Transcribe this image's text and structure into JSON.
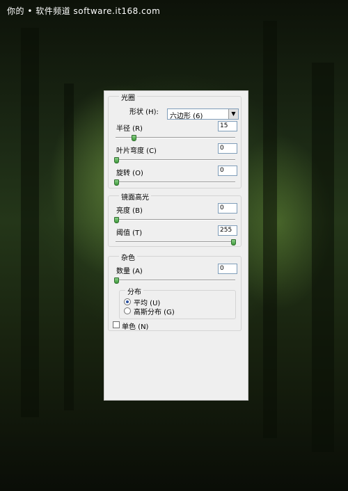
{
  "watermark": "你的 • 软件频道 software.it168.com",
  "iris": {
    "legend": "光圈",
    "shape_label": "形状 (H):",
    "shape_value": "六边形 (6)",
    "radius_label": "半径 (R)",
    "radius_value": "15",
    "radius_level": 0.15,
    "curvature_label": "叶片弯度 (C)",
    "curvature_value": "0",
    "curvature_level": 0,
    "rotation_label": "旋转 (O)",
    "rotation_value": "0",
    "rotation_level": 0
  },
  "specular": {
    "legend": "镜面高光",
    "brightness_label": "亮度 (B)",
    "brightness_value": "0",
    "brightness_level": 0,
    "threshold_label": "阈值 (T)",
    "threshold_value": "255",
    "threshold_level": 1
  },
  "noise": {
    "legend": "杂色",
    "amount_label": "数量 (A)",
    "amount_value": "0",
    "amount_level": 0,
    "distribution": {
      "legend": "分布",
      "uniform_label": "平均 (U)",
      "gaussian_label": "高斯分布 (G)",
      "selected": "uniform"
    },
    "mono_label": "单色 (N)",
    "mono_checked": false
  }
}
